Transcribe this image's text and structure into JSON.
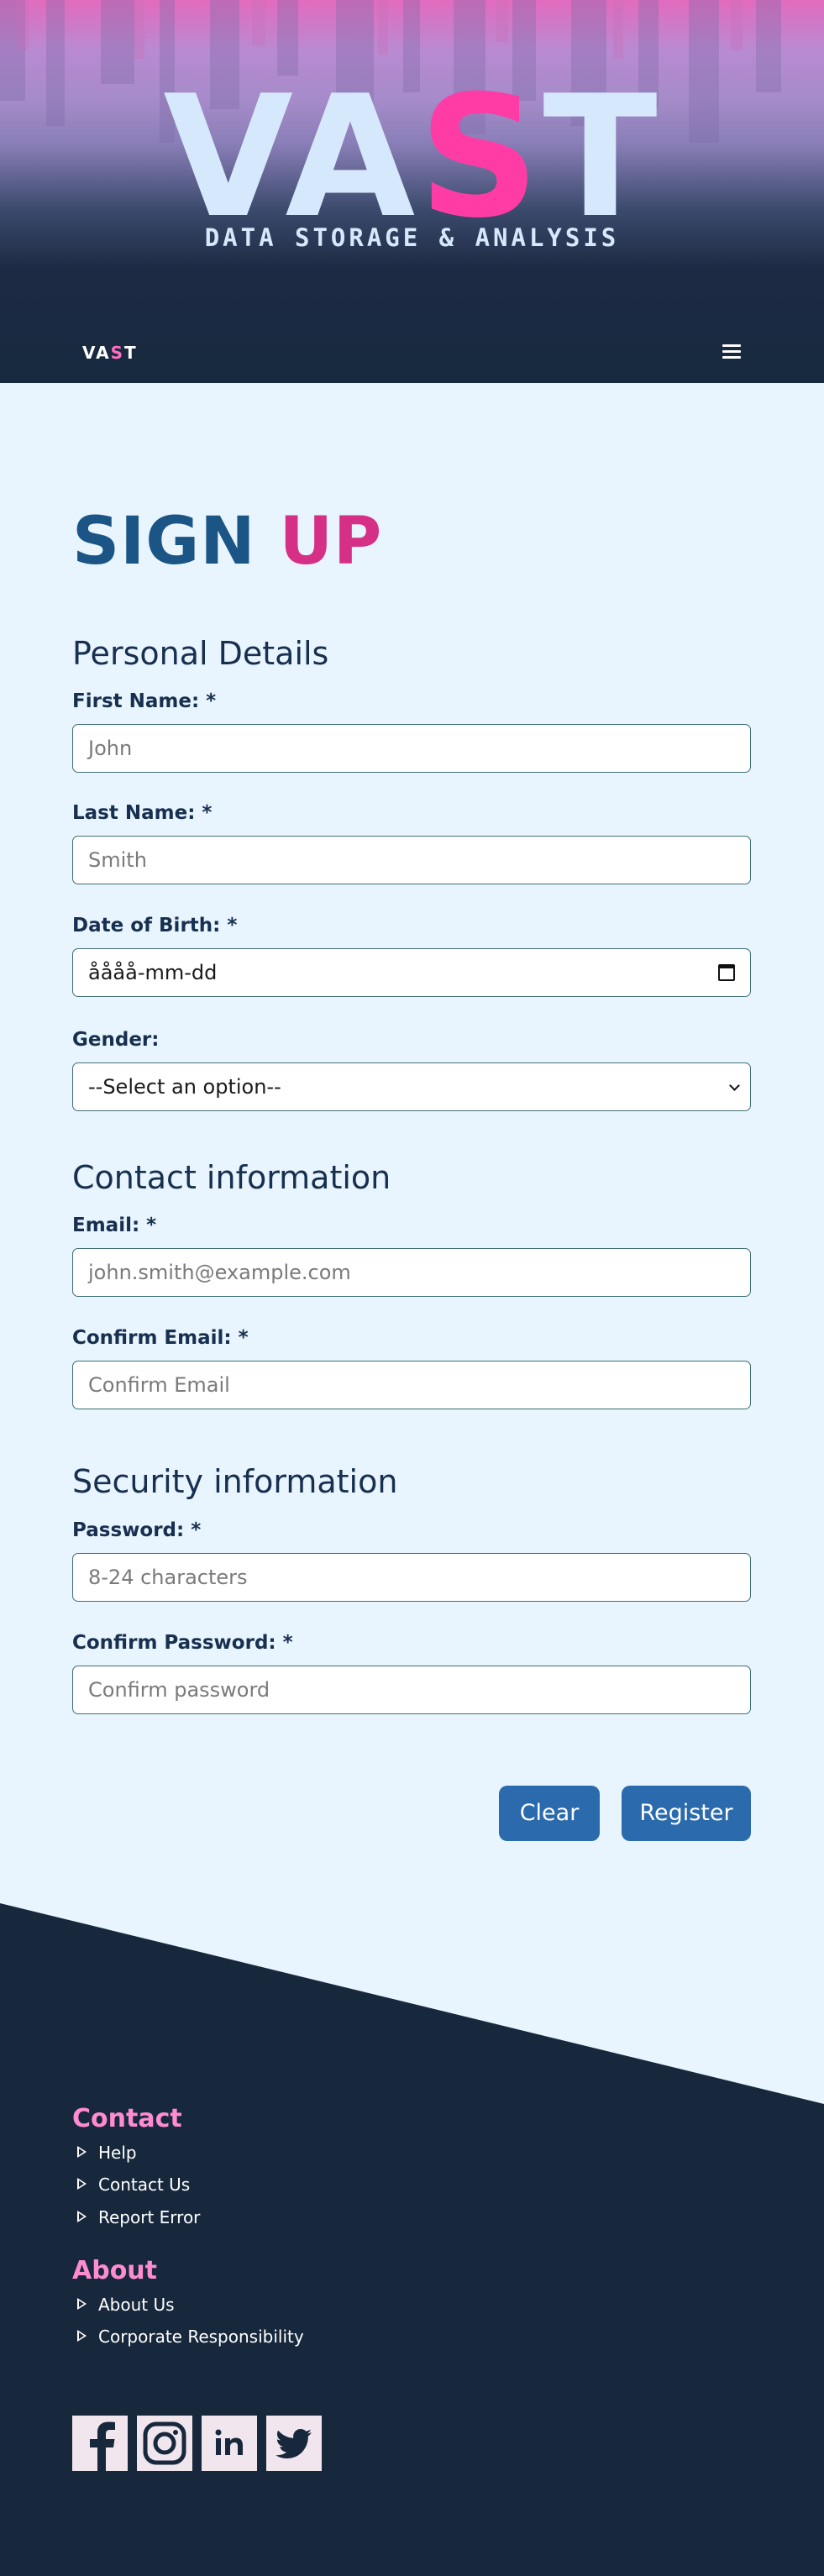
{
  "hero": {
    "title_part1": "VA",
    "title_part2": "S",
    "title_part3": "T",
    "subtitle": "DATA STORAGE & ANALYSIS"
  },
  "navbar": {
    "logo_part1": "VA",
    "logo_part2": "S",
    "logo_part3": "T",
    "menu_icon": "hamburger-menu-icon"
  },
  "page": {
    "title_part1": "SIGN",
    "title_part2": "UP"
  },
  "sections": {
    "personal": "Personal Details",
    "contact": "Contact information",
    "security": "Security information"
  },
  "fields": {
    "first_name": {
      "label": "First Name: *",
      "placeholder": "John"
    },
    "last_name": {
      "label": "Last Name: *",
      "placeholder": "Smith"
    },
    "dob": {
      "label": "Date of Birth: *",
      "value": "åååå-mm-dd"
    },
    "gender": {
      "label": "Gender:",
      "value": "--Select an option--"
    },
    "email": {
      "label": "Email: *",
      "placeholder": "john.smith@example.com"
    },
    "confirm_email": {
      "label": "Confirm Email: *",
      "placeholder": "Confirm Email"
    },
    "password": {
      "label": "Password: *",
      "placeholder": "8-24 characters"
    },
    "confirm_password": {
      "label": "Confirm Password: *",
      "placeholder": "Confirm password"
    }
  },
  "buttons": {
    "clear": "Clear",
    "register": "Register"
  },
  "footer": {
    "contact_heading": "Contact",
    "contact_links": [
      "Help",
      "Contact Us",
      "Report Error"
    ],
    "about_heading": "About",
    "about_links": [
      "About Us",
      "Corporate Responsibility"
    ],
    "social_icons": [
      "facebook-icon",
      "instagram-icon",
      "linkedin-icon",
      "twitter-icon"
    ]
  },
  "colors": {
    "accent_pink": "#ff3ca6",
    "title_blue": "#1b5585",
    "button_blue": "#2a6aad",
    "footer_bg": "#17283c",
    "page_bg": "#e8f4fe"
  }
}
